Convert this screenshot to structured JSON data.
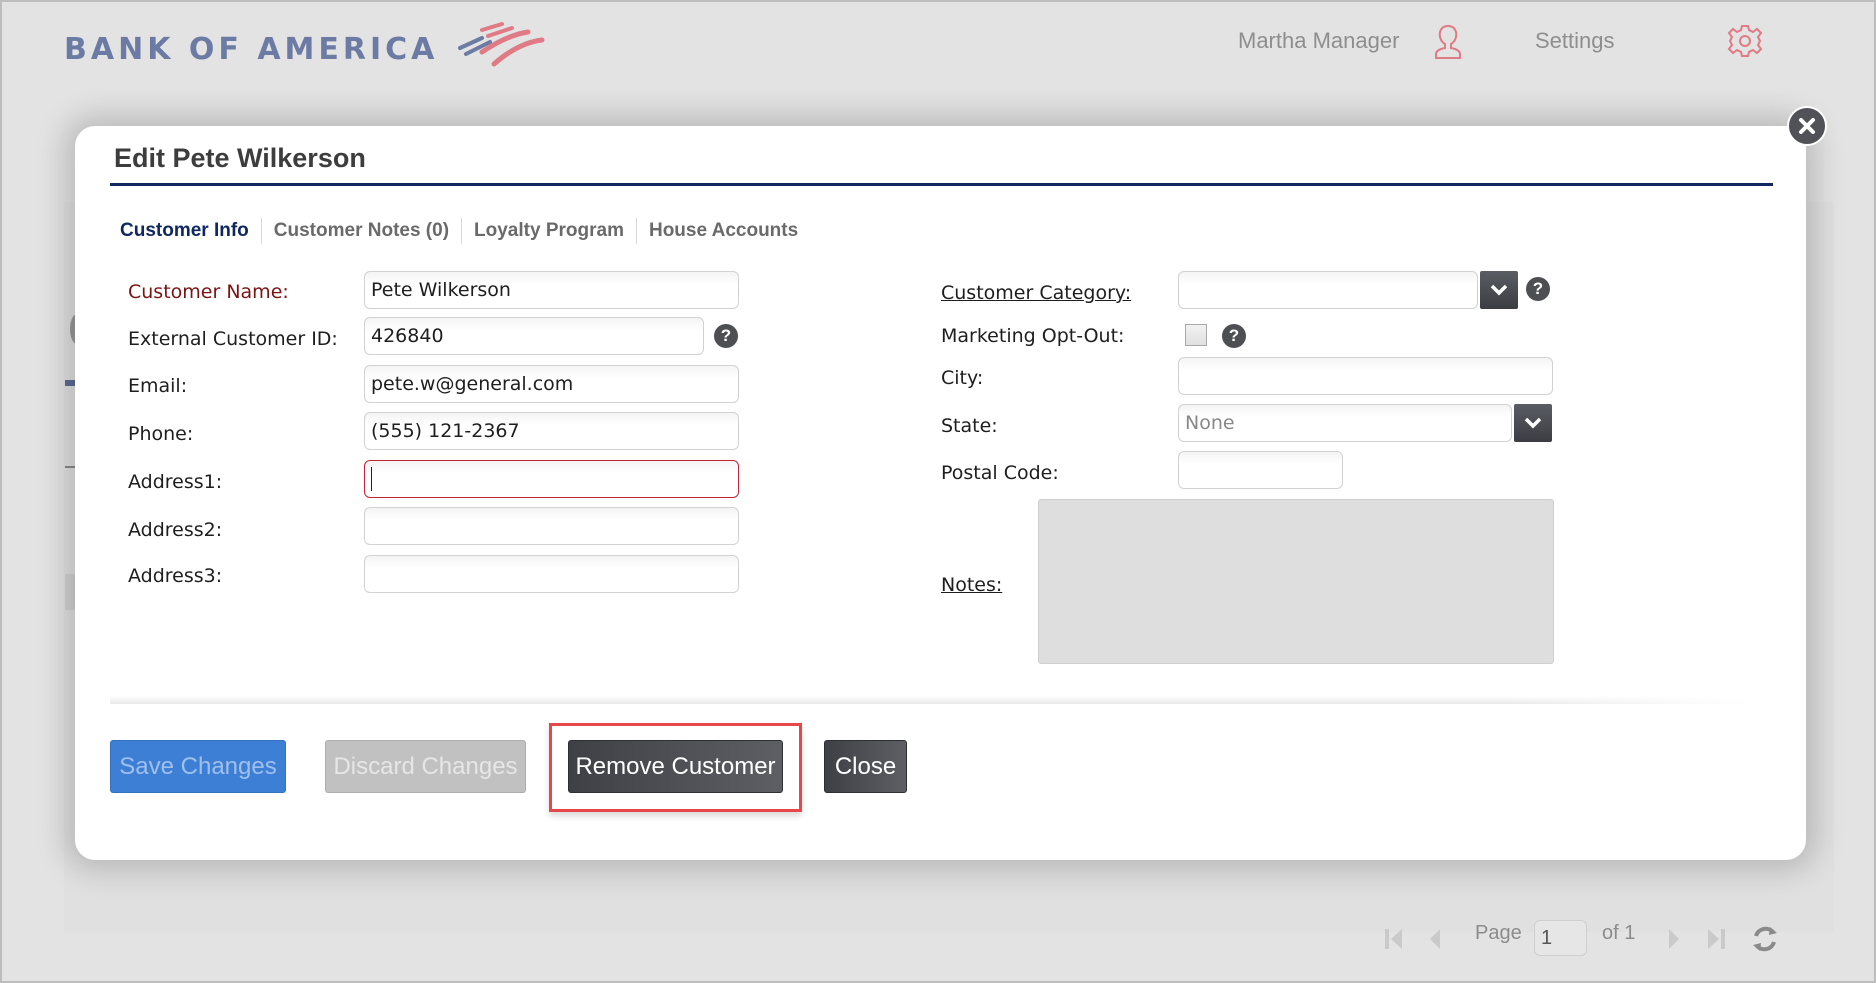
{
  "header": {
    "brand": "BANK OF AMERICA",
    "user_name": "Martha Manager",
    "settings_label": "Settings",
    "colors": {
      "brand_blue": "#6b7ba4",
      "brand_red": "#e07a84"
    }
  },
  "modal": {
    "title": "Edit Pete Wilkerson",
    "close_icon": "close-circle-icon",
    "tabs": [
      {
        "label": "Customer Info",
        "active": true
      },
      {
        "label": "Customer Notes (0)",
        "active": false
      },
      {
        "label": "Loyalty Program",
        "active": false
      },
      {
        "label": "House Accounts",
        "active": false
      }
    ],
    "left_fields": [
      {
        "label": "Customer Name:",
        "value": "Pete Wilkerson",
        "required": true
      },
      {
        "label": "External Customer ID:",
        "value": "426840",
        "help": true
      },
      {
        "label": "Email:",
        "value": "pete.w@general.com"
      },
      {
        "label": "Phone:",
        "value": "(555) 121-2367"
      },
      {
        "label": "Address1:",
        "value": "",
        "focused": true
      },
      {
        "label": "Address2:",
        "value": ""
      },
      {
        "label": "Address3:",
        "value": ""
      }
    ],
    "right_fields": {
      "category": {
        "label": "Customer Category:",
        "value": ""
      },
      "marketing": {
        "label": "Marketing Opt-Out:",
        "checked": false
      },
      "city": {
        "label": "City:",
        "value": ""
      },
      "state": {
        "label": "State:",
        "value": "None"
      },
      "postal": {
        "label": "Postal Code:",
        "value": ""
      },
      "notes": {
        "label": "Notes:",
        "value": ""
      }
    },
    "buttons": {
      "save": "Save Changes",
      "discard": "Discard Changes",
      "remove": "Remove Customer",
      "close": "Close"
    },
    "help_glyph": "?"
  },
  "pagination": {
    "page_label": "Page",
    "current_page": "1",
    "of_label": "of 1"
  }
}
